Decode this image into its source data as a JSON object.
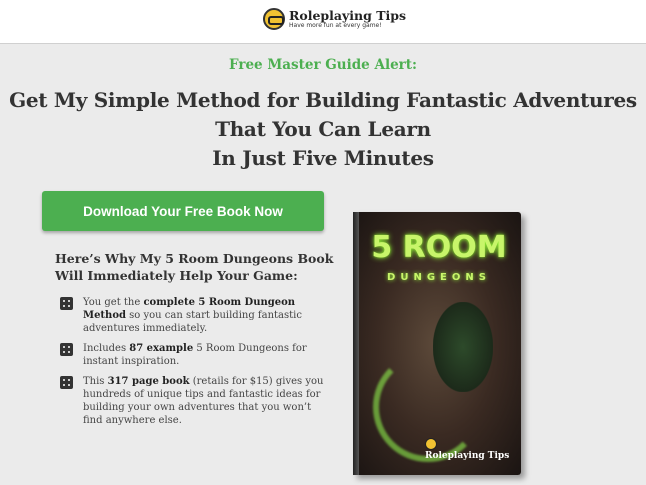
{
  "header": {
    "logo_title": "Roleplaying Tips",
    "logo_tagline": "Have more fun at every game!"
  },
  "hero": {
    "alert": "Free Master Guide Alert:",
    "headline_line1": "Get My Simple Method for Building Fantastic Adventures",
    "headline_line2": "That You Can Learn",
    "headline_line3": "In Just Five Minutes"
  },
  "cta": {
    "label": "Download Your Free Book Now"
  },
  "why": {
    "heading": "Here’s Why My 5 Room Dungeons Book Will Immediately Help Your Game:"
  },
  "benefits": [
    {
      "pre": "You get the ",
      "bold": "complete 5 Room Dungeon Method",
      "post": " so you can start building fantastic adventures immediately."
    },
    {
      "pre": "Includes ",
      "bold": "87 example",
      "post": " 5 Room Dungeons for instant inspiration."
    },
    {
      "pre": "This ",
      "bold": "317 page book",
      "post": " (retails for $15) gives you hundreds of unique tips and fantastic ideas for building your own adventures that you won’t find anywhere else."
    }
  ],
  "book": {
    "title": "5 ROOM",
    "subtitle": "DUNGEONS",
    "brand": "Roleplaying Tips"
  },
  "colors": {
    "accent_green": "#4caf50",
    "background": "#ebebeb",
    "book_glow": "#c8f56a"
  },
  "icons": [
    "logo-icon",
    "dice-icon"
  ]
}
